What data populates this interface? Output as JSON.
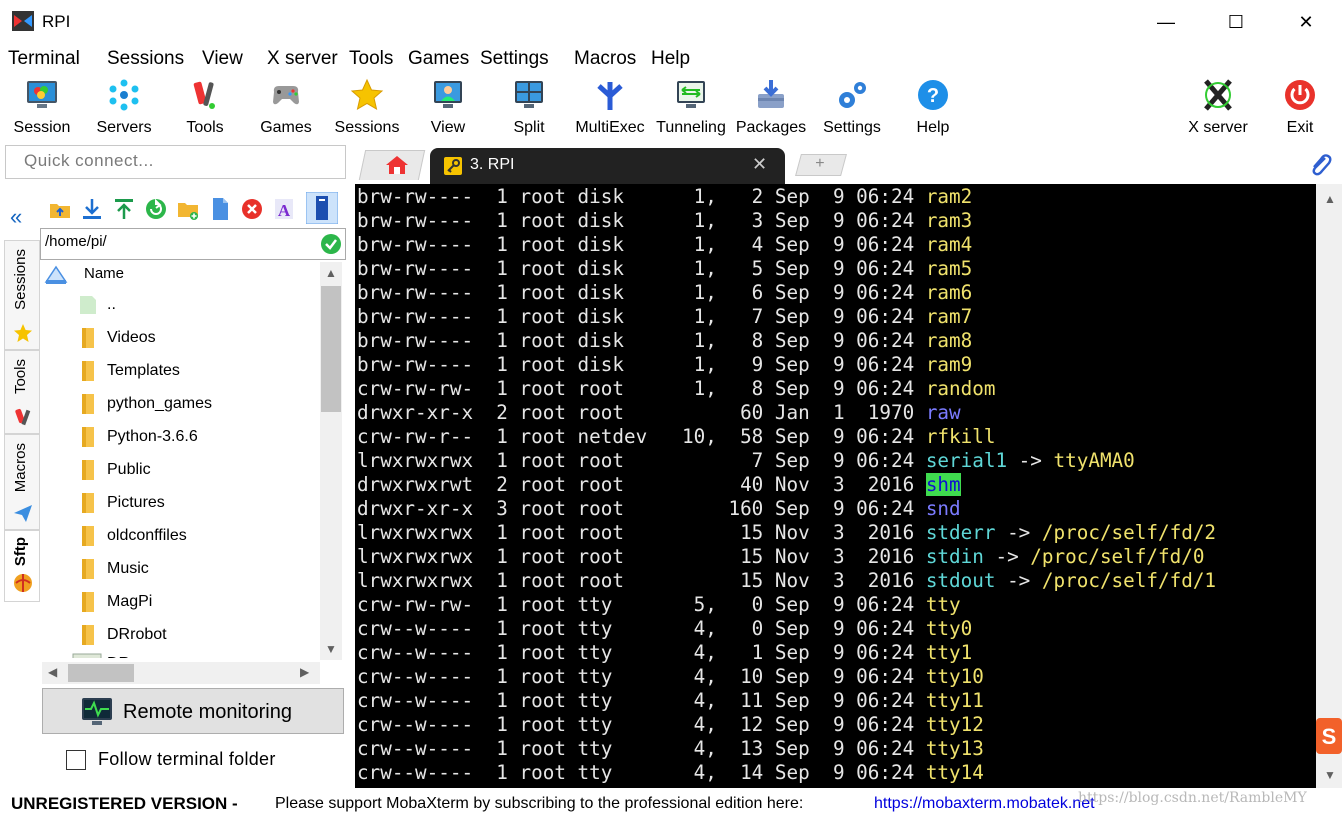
{
  "window": {
    "title": "RPI",
    "min": "—",
    "max": "☐",
    "close": "✕"
  },
  "menu": [
    "Terminal",
    "Sessions",
    "View",
    "X server",
    "Tools",
    "Games",
    "Settings",
    "Macros",
    "Help"
  ],
  "toolbar": {
    "session": "Session",
    "servers": "Servers",
    "tools": "Tools",
    "games": "Games",
    "sessions": "Sessions",
    "view": "View",
    "split": "Split",
    "multiexec": "MultiExec",
    "tunneling": "Tunneling",
    "packages": "Packages",
    "settings": "Settings",
    "help": "Help",
    "xserver": "X server",
    "exit": "Exit"
  },
  "quick_connect": {
    "placeholder": "Quick connect..."
  },
  "tabs": {
    "active_label": "3. RPI",
    "close": "✕",
    "add": "+"
  },
  "sidebar": {
    "sessions": "Sessions",
    "tools": "Tools",
    "macros": "Macros",
    "sftp": "Sftp",
    "collapse": "«"
  },
  "sftp": {
    "path": "/home/pi/",
    "column_name": "Name",
    "files": [
      "..",
      "Videos",
      "Templates",
      "python_games",
      "Python-3.6.6",
      "Public",
      "Pictures",
      "oldconffiles",
      "Music",
      "MagPi",
      "DRrobot",
      "DR"
    ],
    "remote_monitoring": "Remote monitoring",
    "follow_folder": "Follow terminal folder"
  },
  "terminal": {
    "lines": [
      {
        "meta": "brw-rw----  1 root disk      1,   2 Sep  9 06:24 ",
        "name": "ram2",
        "cls": "nm"
      },
      {
        "meta": "brw-rw----  1 root disk      1,   3 Sep  9 06:24 ",
        "name": "ram3",
        "cls": "nm"
      },
      {
        "meta": "brw-rw----  1 root disk      1,   4 Sep  9 06:24 ",
        "name": "ram4",
        "cls": "nm"
      },
      {
        "meta": "brw-rw----  1 root disk      1,   5 Sep  9 06:24 ",
        "name": "ram5",
        "cls": "nm"
      },
      {
        "meta": "brw-rw----  1 root disk      1,   6 Sep  9 06:24 ",
        "name": "ram6",
        "cls": "nm"
      },
      {
        "meta": "brw-rw----  1 root disk      1,   7 Sep  9 06:24 ",
        "name": "ram7",
        "cls": "nm"
      },
      {
        "meta": "brw-rw----  1 root disk      1,   8 Sep  9 06:24 ",
        "name": "ram8",
        "cls": "nm"
      },
      {
        "meta": "brw-rw----  1 root disk      1,   9 Sep  9 06:24 ",
        "name": "ram9",
        "cls": "nm"
      },
      {
        "meta": "crw-rw-rw-  1 root root      1,   8 Sep  9 06:24 ",
        "name": "random",
        "cls": "nm"
      },
      {
        "meta": "drwxr-xr-x  2 root root          60 Jan  1  1970 ",
        "name": "raw",
        "cls": "dir"
      },
      {
        "meta": "crw-rw-r--  1 root netdev   10,  58 Sep  9 06:24 ",
        "name": "rfkill",
        "cls": "nm"
      },
      {
        "meta": "lrwxrwxrwx  1 root root           7 Sep  9 06:24 ",
        "name": "serial1",
        "cls": "lnk",
        "arrow": " -> ",
        "target": "ttyAMA0"
      },
      {
        "meta": "drwxrwxrwt  2 root root          40 Nov  3  2016 ",
        "name": "shm",
        "cls": "hl"
      },
      {
        "meta": "drwxr-xr-x  3 root root         160 Sep  9 06:24 ",
        "name": "snd",
        "cls": "dir"
      },
      {
        "meta": "lrwxrwxrwx  1 root root          15 Nov  3  2016 ",
        "name": "stderr",
        "cls": "lnk",
        "arrow": " -> ",
        "target": "/proc/self/fd/2"
      },
      {
        "meta": "lrwxrwxrwx  1 root root          15 Nov  3  2016 ",
        "name": "stdin",
        "cls": "lnk",
        "arrow": " -> ",
        "target": "/proc/self/fd/0"
      },
      {
        "meta": "lrwxrwxrwx  1 root root          15 Nov  3  2016 ",
        "name": "stdout",
        "cls": "lnk",
        "arrow": " -> ",
        "target": "/proc/self/fd/1"
      },
      {
        "meta": "crw-rw-rw-  1 root tty       5,   0 Sep  9 06:24 ",
        "name": "tty",
        "cls": "nm"
      },
      {
        "meta": "crw--w----  1 root tty       4,   0 Sep  9 06:24 ",
        "name": "tty0",
        "cls": "nm"
      },
      {
        "meta": "crw--w----  1 root tty       4,   1 Sep  9 06:24 ",
        "name": "tty1",
        "cls": "nm"
      },
      {
        "meta": "crw--w----  1 root tty       4,  10 Sep  9 06:24 ",
        "name": "tty10",
        "cls": "nm"
      },
      {
        "meta": "crw--w----  1 root tty       4,  11 Sep  9 06:24 ",
        "name": "tty11",
        "cls": "nm"
      },
      {
        "meta": "crw--w----  1 root tty       4,  12 Sep  9 06:24 ",
        "name": "tty12",
        "cls": "nm"
      },
      {
        "meta": "crw--w----  1 root tty       4,  13 Sep  9 06:24 ",
        "name": "tty13",
        "cls": "nm"
      },
      {
        "meta": "crw--w----  1 root tty       4,  14 Sep  9 06:24 ",
        "name": "tty14",
        "cls": "nm"
      }
    ]
  },
  "status": {
    "unregistered": "UNREGISTERED VERSION  -",
    "support": "Please support MobaXterm by subscribing to the professional edition here:",
    "link": "https://mobaxterm.mobatek.net",
    "watermark": "https://blog.csdn.net/RambleMY"
  },
  "colors": {
    "terminal_bg": "#000000",
    "file_name": "#f0e26c",
    "directory": "#7b7bff",
    "symlink": "#5fd7d7",
    "highlight_bg": "#3fdc4f",
    "link": "#0000dd"
  }
}
